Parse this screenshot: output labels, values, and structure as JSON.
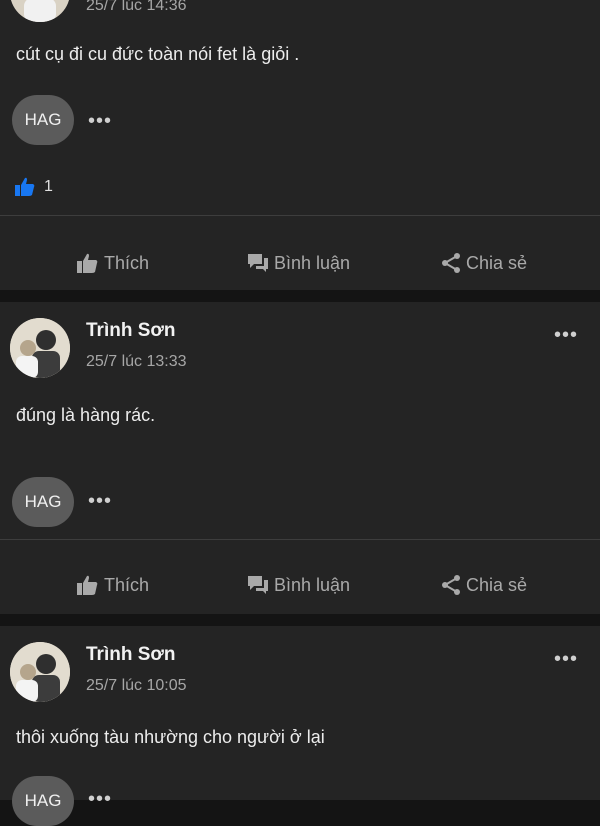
{
  "posts": [
    {
      "time": "25/7 lúc 14:36",
      "text": "cút cụ đi cu đức toàn nói fet là giỏi .",
      "tag": "HAG",
      "likes": "1"
    },
    {
      "author": "Trình Sơn",
      "time": "25/7 lúc 13:33",
      "text": "đúng là hàng rác.",
      "tag": "HAG"
    },
    {
      "author": "Trình Sơn",
      "time": "25/7 lúc 10:05",
      "text": "thôi xuống tàu nhường cho người ở lại",
      "tag": "HAG"
    }
  ],
  "actions": {
    "like": "Thích",
    "comment": "Bình luận",
    "share": "Chia sẻ"
  },
  "more_glyph": "•••",
  "icons": [
    "like-icon",
    "comment-icon",
    "share-icon",
    "more-icon",
    "avatar"
  ],
  "colors": {
    "background": "#141414",
    "card": "#242424",
    "like_blue": "#1877f2",
    "tag_pill": "#5b5b5b"
  }
}
